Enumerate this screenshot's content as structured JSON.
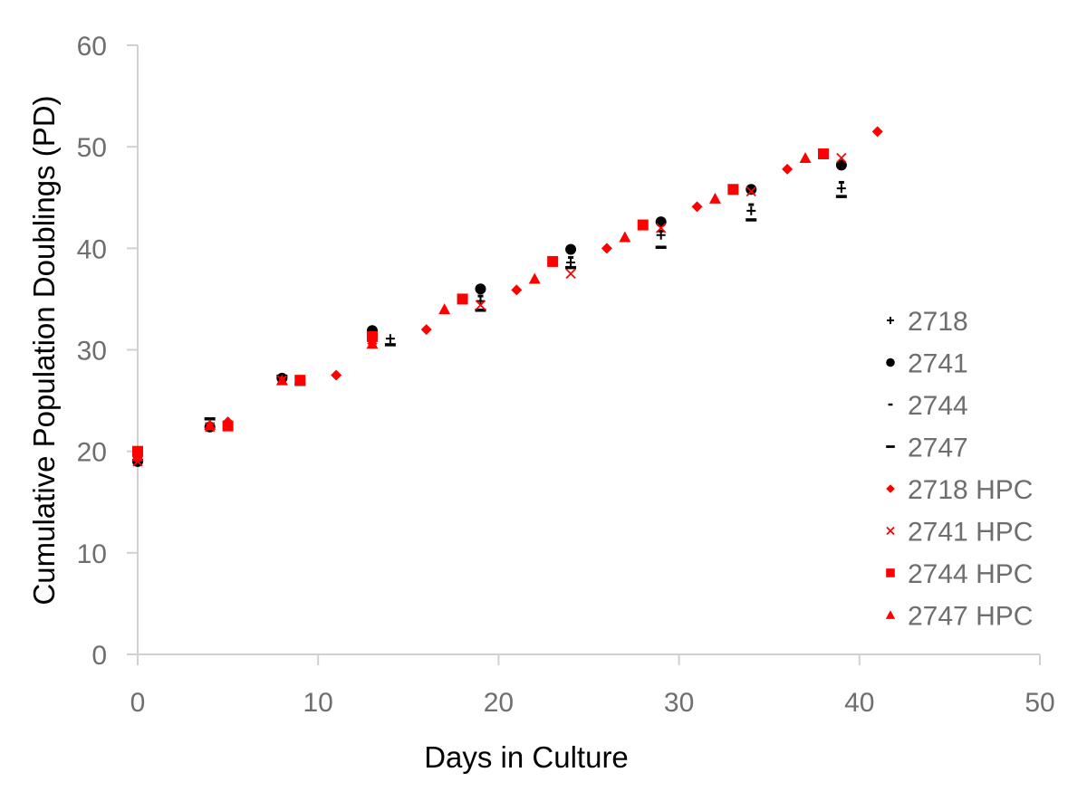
{
  "chart_data": {
    "type": "scatter",
    "title": "",
    "xlabel": "Days in Culture",
    "ylabel": "Cumulative Population Doublings (PD)",
    "xlim": [
      0,
      50
    ],
    "ylim": [
      0,
      60
    ],
    "xticks": [
      0,
      10,
      20,
      30,
      40,
      50
    ],
    "yticks": [
      0,
      10,
      20,
      30,
      40,
      50,
      60
    ],
    "grid": false,
    "legend_position": "right",
    "series": [
      {
        "name": "2718",
        "marker": "plus",
        "color": "#000000",
        "x": [
          0,
          4,
          8,
          13,
          14,
          19,
          24,
          29,
          34,
          39
        ],
        "y": [
          19.0,
          22.6,
          27.2,
          31.0,
          31.1,
          34.8,
          38.6,
          41.3,
          43.7,
          45.9
        ]
      },
      {
        "name": "2741",
        "marker": "circle",
        "color": "#000000",
        "x": [
          0,
          4,
          8,
          13,
          19,
          24,
          29,
          34,
          39
        ],
        "y": [
          19.0,
          22.4,
          27.2,
          31.9,
          36.0,
          39.9,
          42.6,
          45.8,
          48.2
        ]
      },
      {
        "name": "2744",
        "marker": "dash-short",
        "color": "#000000",
        "x": [
          0,
          4,
          8,
          13,
          19,
          24,
          29,
          34,
          39
        ],
        "y": [
          19.3,
          22.5,
          27.1,
          31.3,
          35.3,
          39.1,
          41.7,
          44.3,
          46.5
        ]
      },
      {
        "name": "2747",
        "marker": "dash",
        "color": "#000000",
        "x": [
          0,
          4,
          8,
          9,
          13,
          14,
          19,
          24,
          29,
          34,
          39
        ],
        "y": [
          19.1,
          23.2,
          27.4,
          26.6,
          31.5,
          30.5,
          33.9,
          38.1,
          40.1,
          42.8,
          45.1
        ]
      },
      {
        "name": "2718 HPC",
        "marker": "diamond",
        "color": "#ff0000",
        "x": [
          0,
          5,
          11,
          16,
          21,
          26,
          31,
          36,
          41
        ],
        "y": [
          19.5,
          22.9,
          27.5,
          32.0,
          35.9,
          40.0,
          44.1,
          47.8,
          51.5
        ]
      },
      {
        "name": "2741 HPC",
        "marker": "x",
        "color": "#ff0000",
        "x": [
          0,
          4,
          8,
          13,
          19,
          24,
          29,
          34,
          39
        ],
        "y": [
          19.0,
          22.4,
          27.0,
          31.0,
          34.4,
          37.5,
          42.0,
          45.6,
          48.9
        ]
      },
      {
        "name": "2744 HPC",
        "marker": "square",
        "color": "#ff0000",
        "x": [
          0,
          5,
          9,
          13,
          18,
          23,
          28,
          33,
          38
        ],
        "y": [
          20.0,
          22.5,
          27.0,
          31.3,
          35.0,
          38.7,
          42.3,
          45.8,
          49.3
        ]
      },
      {
        "name": "2747 HPC",
        "marker": "triangle",
        "color": "#ff0000",
        "x": [
          0,
          4,
          8,
          13,
          17,
          22,
          27,
          32,
          37
        ],
        "y": [
          19.5,
          22.6,
          27.0,
          30.6,
          34.0,
          37.0,
          41.1,
          44.9,
          48.9
        ]
      }
    ]
  }
}
